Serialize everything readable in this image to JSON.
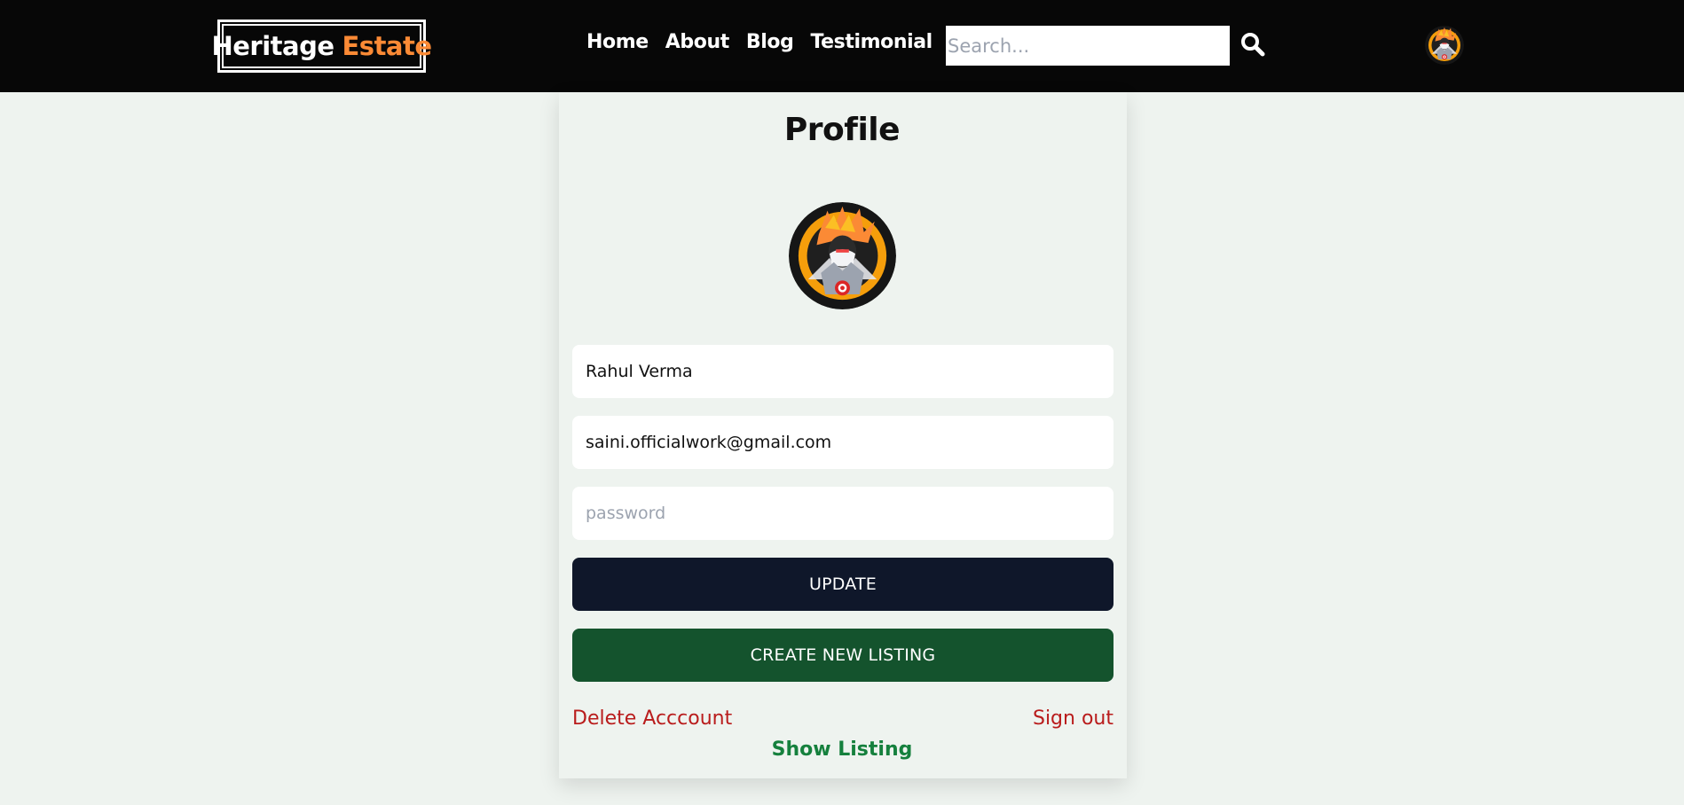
{
  "brand": {
    "name_part1": "Heritage",
    "name_part2": "Estate",
    "accent_color": "#fb8a35"
  },
  "nav": {
    "links": [
      "Home",
      "About",
      "Blog",
      "Testimonial"
    ]
  },
  "search": {
    "placeholder": "Search...",
    "value": "",
    "icon": "search-icon"
  },
  "profile": {
    "title": "Profile",
    "avatar_icon": "avatar",
    "username": "Rahul Verma",
    "email": "saini.officialwork@gmail.com",
    "password_placeholder": "password",
    "password_value": ""
  },
  "actions": {
    "update_label": "UPDATE",
    "create_listing_label": "CREATE NEW LISTING",
    "delete_account_label": "Delete Acccount",
    "sign_out_label": "Sign out",
    "show_listing_label": "Show Listing"
  },
  "colors": {
    "navbar_bg": "#070707",
    "page_bg": "#eef3ef",
    "update_btn": "#0f172a",
    "create_btn": "#14532d",
    "danger_text": "#b91c1c",
    "success_text": "#15803d"
  }
}
